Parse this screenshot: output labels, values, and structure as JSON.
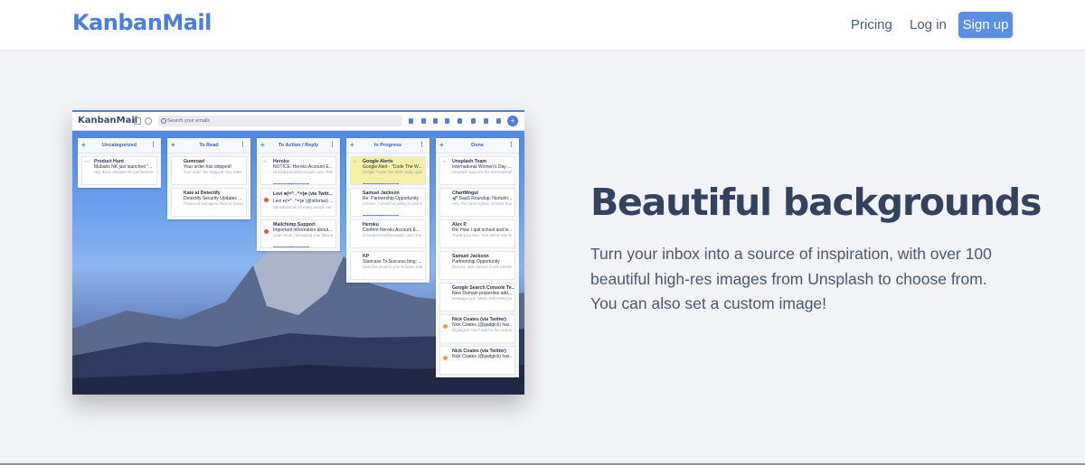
{
  "nav": {
    "brand": "KanbanMail",
    "links": [
      "Pricing",
      "Log in"
    ],
    "signup": "Sign up"
  },
  "hero": {
    "title": "Beautiful backgrounds",
    "body": "Turn your inbox into a source of inspiration, with over 100 beautiful high-res images from Unsplash to choose from. You can also set a custom image!"
  },
  "mockup": {
    "logo": "KanbanMail",
    "search_placeholder": "Search your emails",
    "add_glyph": "+",
    "columns": [
      {
        "title": "Uncategorized",
        "cards": [
          {
            "sender": "Product Hunt",
            "subject": "Mubaris NK just launched \"...",
            "snippet": "Hey there, Mubaris NK just launched \"Programs Dashboard\"",
            "time": "20d"
          }
        ]
      },
      {
        "title": "To Read",
        "cards": [
          {
            "sender": "Gumroad",
            "subject": "Your order has shipped!",
            "snippet": "Your order has shipped! Your order of The Very First Roasting Manual",
            "time": ""
          },
          {
            "sender": "Kate at Detectify",
            "subject": "Detectify Security Updates ...",
            "snippet": "Password managers. Best of Detectify's latest research from Crowd",
            "time": ""
          }
        ]
      },
      {
        "title": "To Action / Reply",
        "cards": [
          {
            "sender": "Heroku",
            "subject": "NOTICE: Heroku Account E...",
            "snippet": "Hi kanbanmail@example.com, This is a notice to inform you that",
            "time": "2d",
            "tag": "OLD EMAIL ADDRESS"
          },
          {
            "sender": "Levi ฅ(=^‥^=)ฅ (via Twitt...",
            "subject": "Levi ฅ(=^‥^=)ฅ (@vtrbrian) ...",
            "snippet": "@kanbanmail So many people are asking us about it. Could you let me know your plans",
            "time": "",
            "dot": "red"
          },
          {
            "sender": "Mailchimp Support",
            "subject": "Important information about...",
            "snippet": "Learn more | Managing your data and how to fix",
            "time": "",
            "dot": "red",
            "tag": "OLD EMAIL ADDRESS"
          }
        ]
      },
      {
        "title": "In Progress",
        "cards": [
          {
            "sender": "Google Alerts",
            "subject": "Google Alert - \"Code The W...",
            "snippet": "Google \"Code The Web\" Daily update - March 4, 2019 NEWS The",
            "time": "1d",
            "highlight": true,
            "tag": "OLD EMAIL ADDRESS"
          },
          {
            "sender": "Samuel Jackson",
            "subject": "Re: Partnership Opportunity",
            "snippet": "Hi there, I would be willing to post some of your articles on my website",
            "time": "",
            "tag": "OLD EMAIL ADDRESS"
          },
          {
            "sender": "Heroku",
            "subject": "Confirm Heroku Account E...",
            "snippet": "Hi kanbanmail@example.com, You recently requested to change your email",
            "time": ""
          },
          {
            "sender": "KP",
            "subject": "Staircase To Success blog: ...",
            "snippet": "View this email in your browser Staircase to Success Insights and",
            "time": ""
          }
        ]
      },
      {
        "title": "Done",
        "cards": [
          {
            "sender": "Unsplash Team",
            "subject": "International Women's Day ...",
            "snippet": "Unsplash supports the International Women's Day Unsplash Logo",
            "time": "1d"
          },
          {
            "sender": "ChartMogul",
            "subject": "🚀 SaaS Roundup: Nurturin...",
            "snippet": "Hey, The latest edition of SaaS Roundup: Discover new tools",
            "time": ""
          },
          {
            "sender": "Alex P.",
            "subject": "Re: How I quit school and le...",
            "snippet": "Thank you! Alex, Your article was featured on Hacker News yesterday",
            "time": ""
          },
          {
            "sender": "Samuel Jackson",
            "subject": "Partnership Opportunity",
            "snippet": "Hi there, Just wanted to ask whether you'd be interested in this",
            "time": ""
          },
          {
            "sender": "Google Search Console Te...",
            "subject": "New Domain properties add...",
            "snippet": "Message type: [WNC-20074936] Search Console now shows",
            "time": ""
          },
          {
            "sender": "Nick Coates (via Twitter)",
            "subject": "Nick Coates (@gadgick) has...",
            "snippet": "@gadgick: Can't wait for the redesign when it's here soon",
            "time": "",
            "dot": "orange"
          },
          {
            "sender": "Nick Coates (via Twitter)",
            "subject": "Nick Coates (@gadgick) has...",
            "snippet": "",
            "time": "",
            "dot": "orange"
          }
        ]
      }
    ]
  }
}
